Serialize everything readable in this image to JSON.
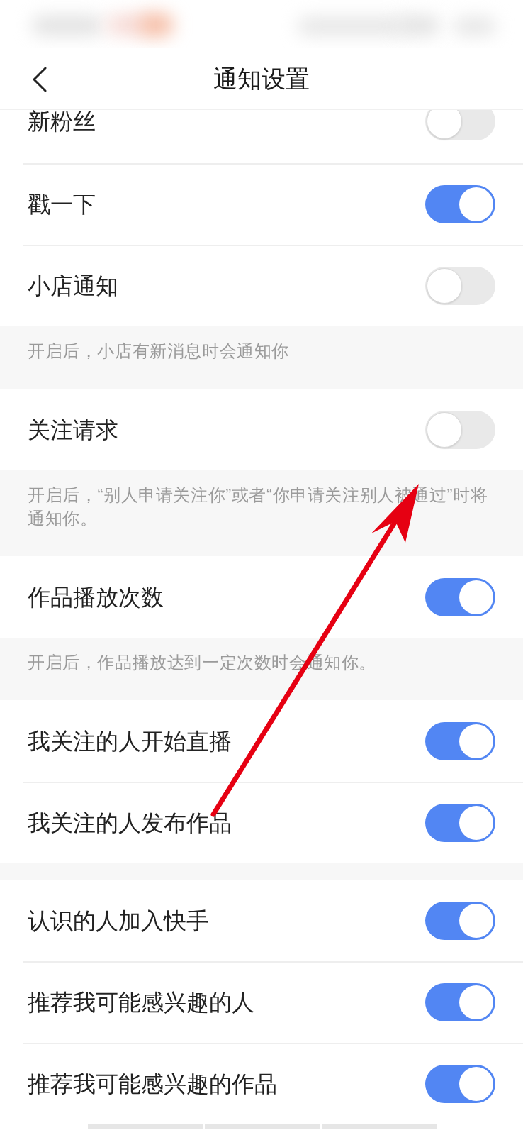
{
  "header": {
    "title": "通知设置"
  },
  "sections": [
    {
      "rows": [
        {
          "label": "新粉丝",
          "on": false
        },
        {
          "label": "戳一下",
          "on": true
        },
        {
          "label": "小店通知",
          "on": false
        }
      ],
      "note": "开启后，小店有新消息时会通知你"
    },
    {
      "rows": [
        {
          "label": "关注请求",
          "on": false
        }
      ],
      "note": "开启后，“别人申请关注你”或者“你申请关注别人被通过”时将通知你。"
    },
    {
      "rows": [
        {
          "label": "作品播放次数",
          "on": true
        }
      ],
      "note": "开启后，作品播放达到一定次数时会通知你。"
    },
    {
      "rows": [
        {
          "label": "我关注的人开始直播",
          "on": true
        },
        {
          "label": "我关注的人发布作品",
          "on": true
        }
      ]
    },
    {
      "rows": [
        {
          "label": "认识的人加入快手",
          "on": true
        },
        {
          "label": "推荐我可能感兴趣的人",
          "on": true
        },
        {
          "label": "推荐我可能感兴趣的作品",
          "on": true
        }
      ]
    }
  ]
}
